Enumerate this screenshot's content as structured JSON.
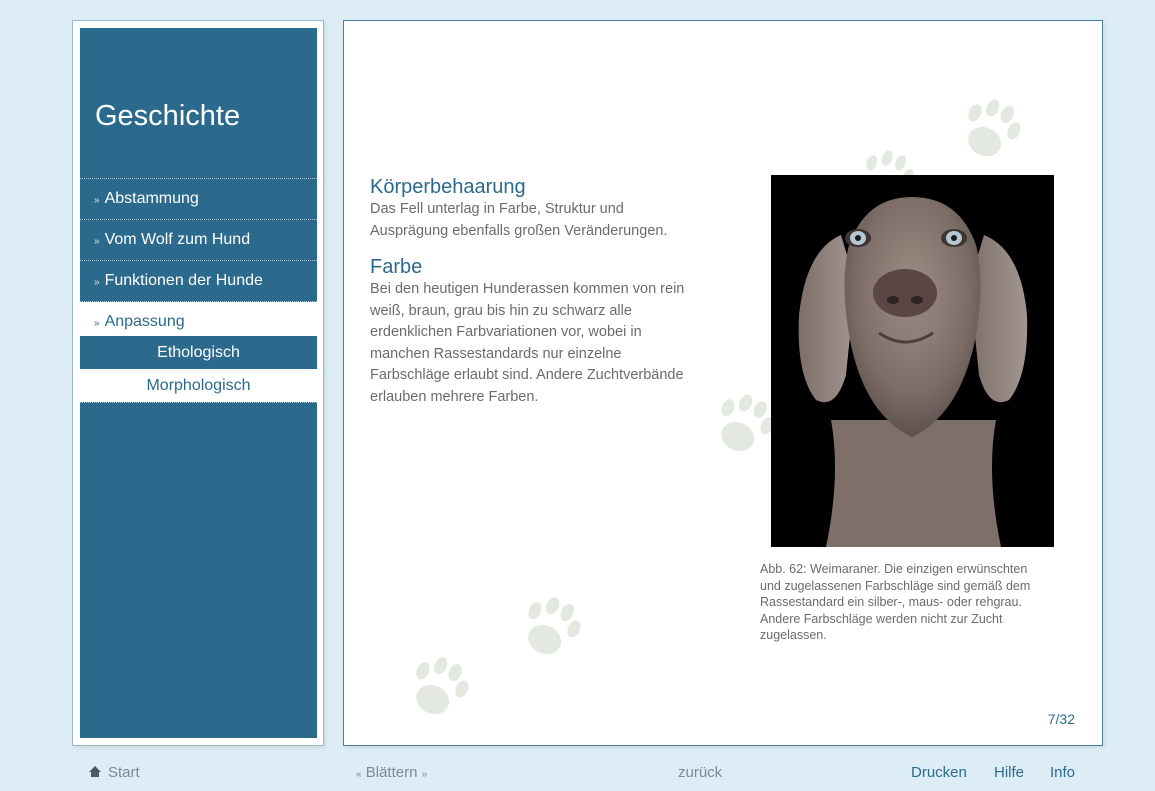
{
  "sidebar": {
    "title": "Geschichte",
    "items": [
      {
        "label": "Abstammung"
      },
      {
        "label": "Vom Wolf zum Hund"
      },
      {
        "label": "Funktionen der Hunde"
      },
      {
        "label": "Anpassung"
      }
    ],
    "subitems": [
      {
        "label": "Ethologisch"
      },
      {
        "label": "Morphologisch"
      }
    ],
    "arrow_glyph": "»"
  },
  "content": {
    "sections": [
      {
        "title": "Körperbehaarung",
        "body": "Das Fell unterlag in Farbe, Struktur und Ausprägung ebenfalls großen Veränderungen."
      },
      {
        "title": "Farbe",
        "body": "Bei den heutigen Hunderassen kommen von rein weiß, braun, grau bis hin zu schwarz alle erdenklichen Farbvariationen vor, wobei in manchen Rassestandards nur einzelne Farbschläge erlaubt sind. Andere Zuchtverbände erlauben mehrere Farben."
      }
    ],
    "caption": "Abb. 62: Weimaraner. Die einzigen erwünschten und zugelassenen Farbschläge sind gemäß dem Rassestandard ein silber-, maus- oder rehgrau. Andere Farbschläge werden nicht zur Zucht zugelassen.",
    "page_counter": "7/32"
  },
  "footer": {
    "start": "Start",
    "blaettern": "Blättern",
    "zurueck": "zurück",
    "drucken": "Drucken",
    "hilfe": "Hilfe",
    "info": "Info"
  },
  "icons": [
    "home-icon",
    "paw-print-icon",
    "dog-photo"
  ],
  "colors": {
    "accent": "#2c6a8d",
    "background": "#ddedf5",
    "text": "#6b6b6b",
    "paw": "#e3e9e1"
  }
}
